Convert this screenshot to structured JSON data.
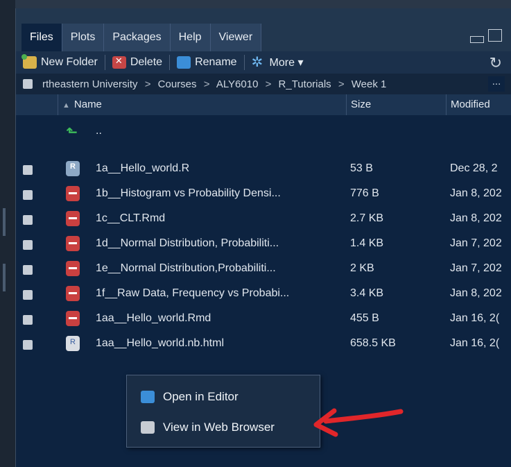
{
  "tabs": [
    {
      "label": "Files",
      "active": true
    },
    {
      "label": "Plots",
      "active": false
    },
    {
      "label": "Packages",
      "active": false
    },
    {
      "label": "Help",
      "active": false
    },
    {
      "label": "Viewer",
      "active": false
    }
  ],
  "toolbar": {
    "new_folder": "New Folder",
    "delete": "Delete",
    "rename": "Rename",
    "more": "More ▾"
  },
  "breadcrumb": {
    "parts": [
      "rtheastern University",
      "Courses",
      "ALY6010",
      "R_Tutorials",
      "Week 1"
    ],
    "separator": ">",
    "more": "..."
  },
  "columns": {
    "name": "Name",
    "size": "Size",
    "modified": "Modified"
  },
  "parent_dir": {
    "name": ".."
  },
  "files": [
    {
      "name": "1a__Hello_world.R",
      "size": "53 B",
      "modified": "Dec 28, 2",
      "icon": "rscript-icon"
    },
    {
      "name": "1b__Histogram vs Probability Densi...",
      "size": "776 B",
      "modified": "Jan 8, 202",
      "icon": "rmd-icon"
    },
    {
      "name": "1c__CLT.Rmd",
      "size": "2.7 KB",
      "modified": "Jan 8, 202",
      "icon": "rmd-icon"
    },
    {
      "name": "1d__Normal Distribution, Probabiliti...",
      "size": "1.4 KB",
      "modified": "Jan 7, 202",
      "icon": "rmd-icon"
    },
    {
      "name": "1e__Normal Distribution,Probabiliti...",
      "size": "2 KB",
      "modified": "Jan 7, 202",
      "icon": "rmd-icon"
    },
    {
      "name": "1f__Raw Data, Frequency vs Probabi...",
      "size": "3.4 KB",
      "modified": "Jan 8, 202",
      "icon": "rmd-icon"
    },
    {
      "name": "1aa__Hello_world.Rmd",
      "size": "455 B",
      "modified": "Jan 16, 2(",
      "icon": "rmd-icon"
    },
    {
      "name": "1aa__Hello_world.nb.html",
      "size": "658.5 KB",
      "modified": "Jan 16, 2(",
      "icon": "html-icon"
    }
  ],
  "context_menu": {
    "open_in_editor": "Open in Editor",
    "view_in_browser": "View in Web Browser"
  },
  "colors": {
    "panel_bg": "#0d2340",
    "annotation_arrow": "#e0262a"
  }
}
